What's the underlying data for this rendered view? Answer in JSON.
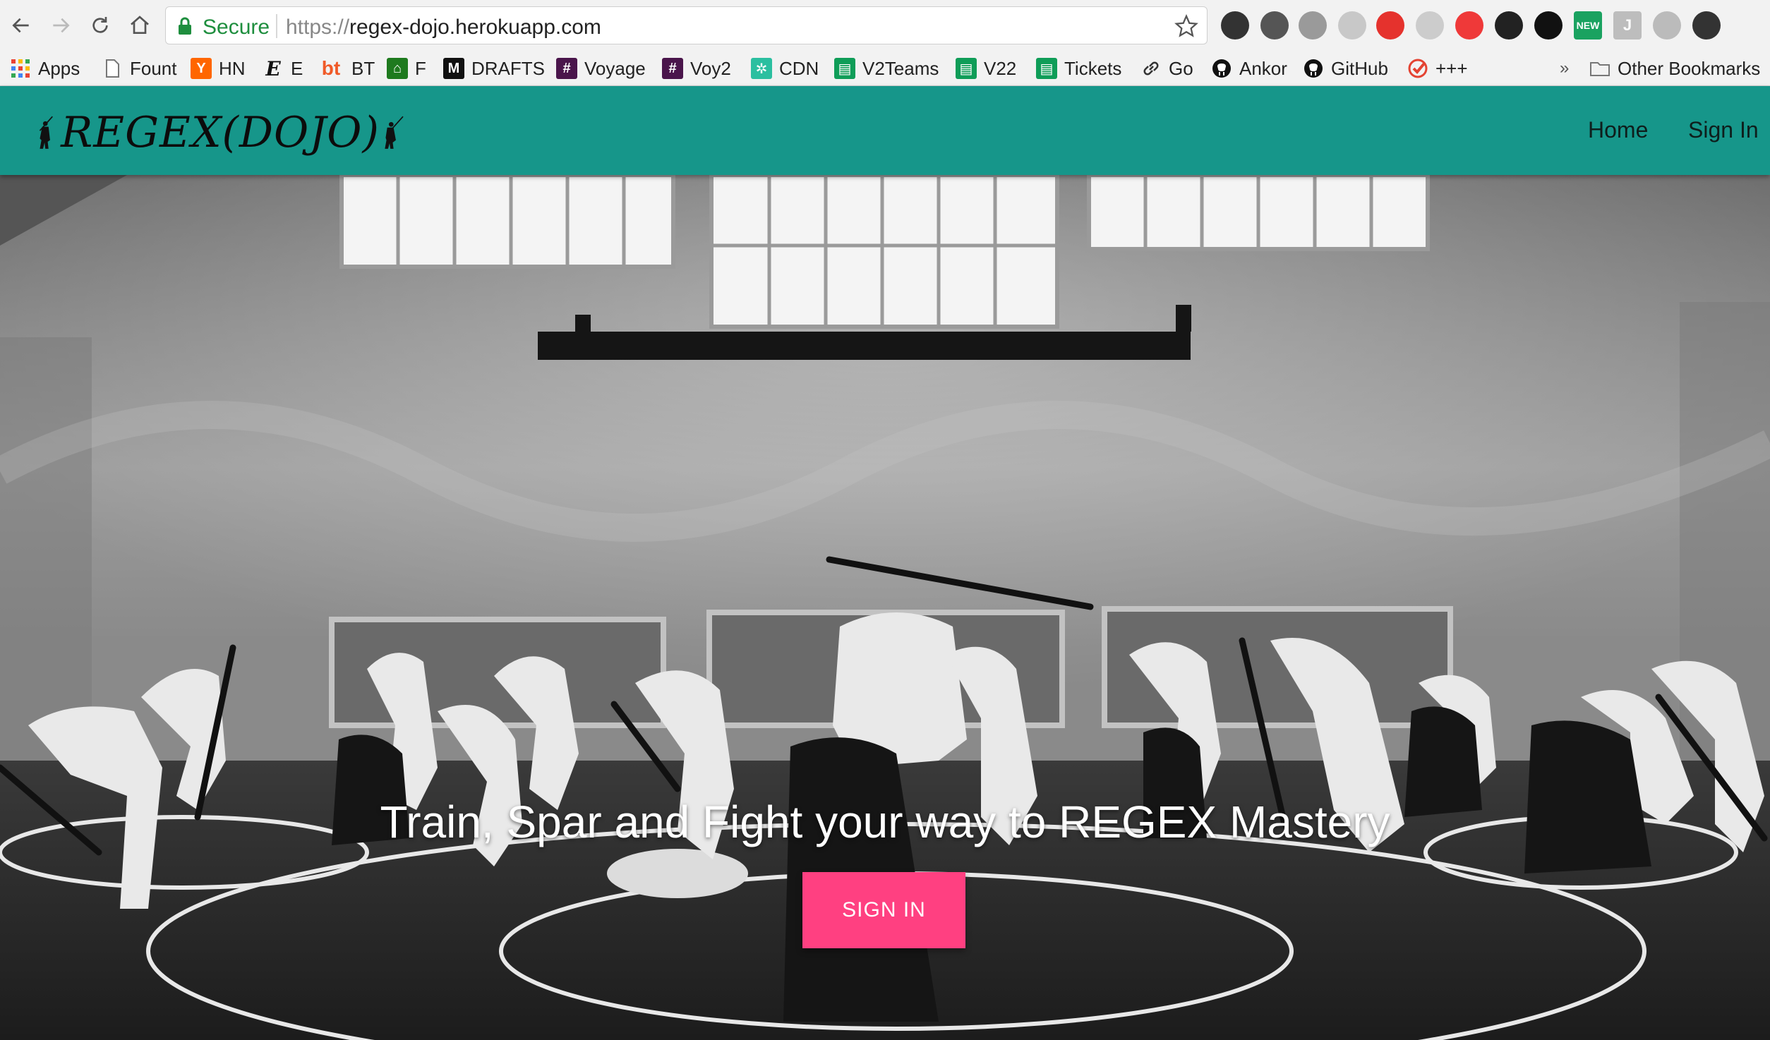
{
  "browser": {
    "secure_label": "Secure",
    "url_scheme": "https://",
    "url_host": "regex-dojo.herokuapp.com",
    "extensions": [
      {
        "icon": "color-wheel-icon",
        "color": "#333333"
      },
      {
        "icon": "evernote-icon",
        "color": "#555555"
      },
      {
        "icon": "globe-icon",
        "color": "#9a9a9a"
      },
      {
        "icon": "leaf-icon",
        "color": "#c8c8c8"
      },
      {
        "icon": "opera-icon",
        "color": "#e5322d"
      },
      {
        "icon": "window-icon",
        "color": "#cccccc"
      },
      {
        "icon": "vivaldi-icon",
        "color": "#ef3939"
      },
      {
        "icon": "dd-icon",
        "color": "#222222"
      },
      {
        "icon": "ninja-icon",
        "color": "#111111"
      },
      {
        "icon": "new-badge-icon",
        "color": "#1aa260",
        "label": "NEW"
      },
      {
        "icon": "j-icon",
        "color": "#bdbdbd",
        "label": "J"
      },
      {
        "icon": "tree-icon",
        "color": "#bbbbbb"
      },
      {
        "icon": "user-icon",
        "color": "#333333"
      }
    ]
  },
  "bookmarks": [
    {
      "label": "Apps",
      "icon": "apps-grid-icon"
    },
    {
      "label": "Fount",
      "icon": "page-icon"
    },
    {
      "label": "HN",
      "icon": "hn-icon",
      "color": "#ff6600",
      "glyph": "Y"
    },
    {
      "label": "E",
      "icon": "e-icon",
      "glyph": "E"
    },
    {
      "label": "BT",
      "icon": "bt-icon",
      "color": "#f05a28",
      "glyph": "bt"
    },
    {
      "label": "F",
      "icon": "f-icon",
      "color": "#1e7a1e",
      "glyph": "⌂"
    },
    {
      "label": "DRAFTS",
      "icon": "medium-icon",
      "color": "#111111",
      "glyph": "M"
    },
    {
      "label": "Voyage",
      "icon": "slack-hash-icon",
      "color": "#4a154b",
      "glyph": "#"
    },
    {
      "label": "Voy2",
      "icon": "slack-hash-icon",
      "color": "#4a154b",
      "glyph": "#"
    },
    {
      "label": "CDN",
      "icon": "cdn-icon",
      "color": "#2bbfa0",
      "glyph": "✲"
    },
    {
      "label": "V2Teams",
      "icon": "sheets-icon",
      "color": "#0f9d58",
      "glyph": "▤"
    },
    {
      "label": "V22",
      "icon": "sheets-icon",
      "color": "#0f9d58",
      "glyph": "▤"
    },
    {
      "label": "Tickets",
      "icon": "sheets-icon",
      "color": "#0f9d58",
      "glyph": "▤"
    },
    {
      "label": "Go",
      "icon": "link-icon",
      "glyph": "🔗"
    },
    {
      "label": "Ankor",
      "icon": "github-icon",
      "color": "#111111",
      "glyph": "●"
    },
    {
      "label": "GitHub",
      "icon": "github-icon",
      "color": "#111111",
      "glyph": "●"
    },
    {
      "label": "+++",
      "icon": "check-icon",
      "color": "#e44332",
      "glyph": "✓"
    }
  ],
  "bookmarks_overflow": "»",
  "other_bookmarks": "Other Bookmarks",
  "site": {
    "logo_text": "REGEX(DOJO)",
    "nav_home": "Home",
    "nav_signin": "Sign In",
    "hero_title": "Train, Spar and Fight your way to REGEX Mastery",
    "hero_button": "SIGN IN",
    "header_color": "#16968a",
    "button_color": "#ff4081"
  }
}
